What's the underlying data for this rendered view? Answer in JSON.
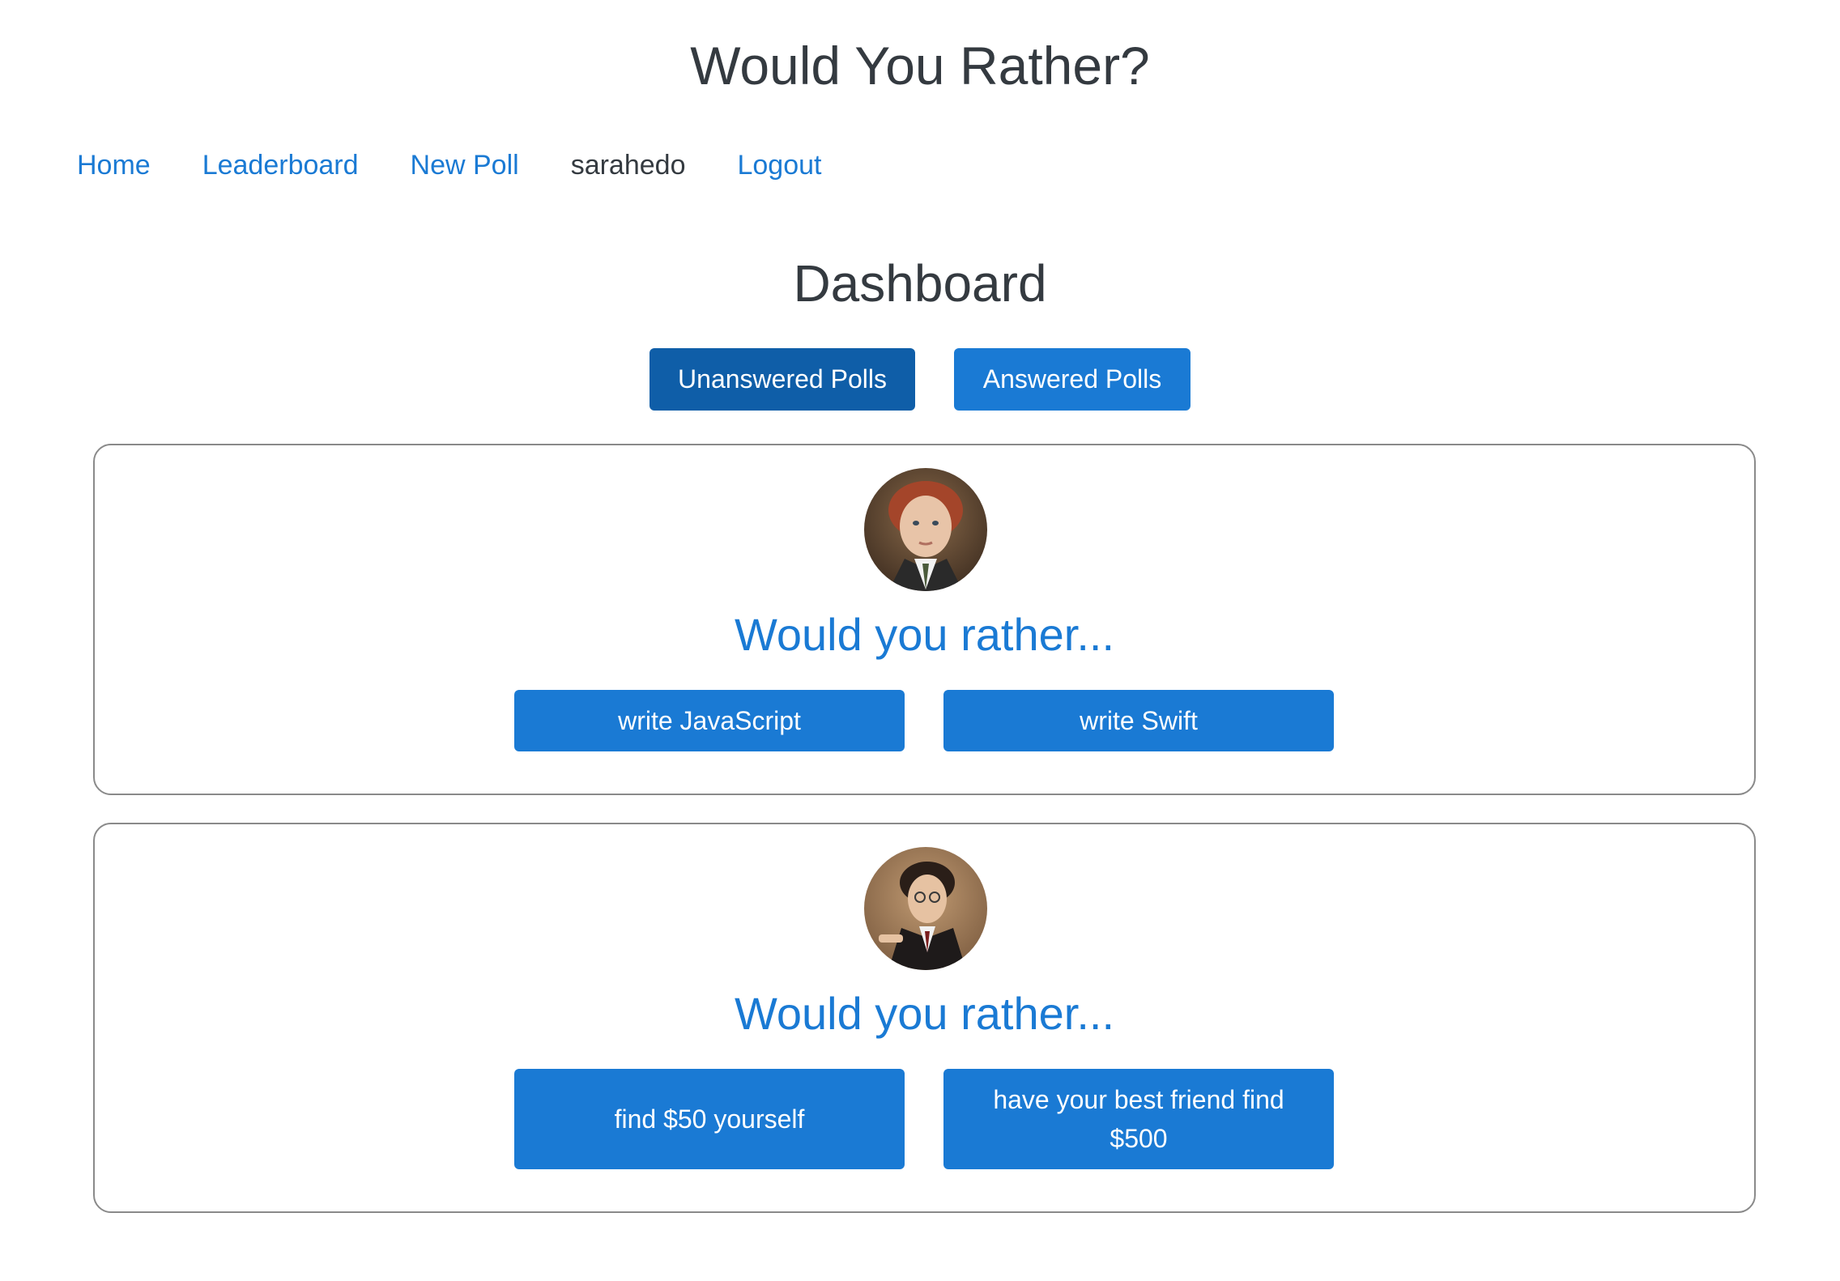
{
  "header": {
    "title": "Would You Rather?"
  },
  "nav": {
    "home": "Home",
    "leaderboard": "Leaderboard",
    "new_poll": "New Poll",
    "username": "sarahedo",
    "logout": "Logout"
  },
  "dashboard": {
    "title": "Dashboard",
    "tabs": {
      "unanswered": "Unanswered Polls",
      "answered": "Answered Polls",
      "active": "unanswered"
    }
  },
  "polls": [
    {
      "question": "Would you rather...",
      "option_one": "write JavaScript",
      "option_two": "write Swift"
    },
    {
      "question": "Would you rather...",
      "option_one": "find $50 yourself",
      "option_two": "have your best friend find $500"
    }
  ],
  "colors": {
    "link": "#1a7ad4",
    "button": "#1a7ad4",
    "button_active": "#0f5ea8",
    "text": "#343a40",
    "card_border": "#8a8a8a"
  }
}
